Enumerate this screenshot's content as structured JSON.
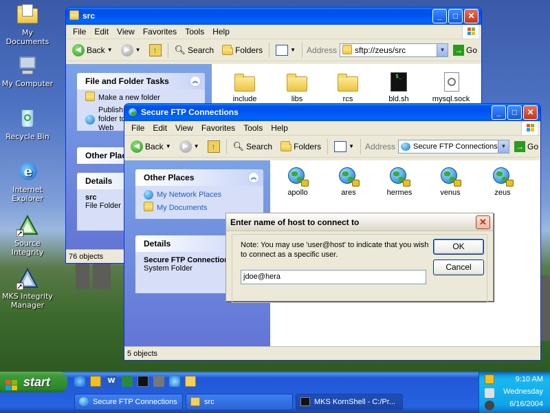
{
  "desktop": {
    "icons": [
      {
        "label": "My Documents",
        "icon": "my-documents-icon"
      },
      {
        "label": "My Computer",
        "icon": "my-computer-icon"
      },
      {
        "label": "Recycle Bin",
        "icon": "recycle-bin-icon"
      },
      {
        "label": "Internet Explorer",
        "icon": "internet-explorer-icon"
      },
      {
        "label": "Source Integrity",
        "icon": "source-integrity-icon"
      },
      {
        "label": "MKS Integrity Manager",
        "icon": "mks-integrity-manager-icon"
      }
    ]
  },
  "src_window": {
    "title": "src",
    "menu": [
      "File",
      "Edit",
      "View",
      "Favorites",
      "Tools",
      "Help"
    ],
    "toolbar": {
      "back": "Back",
      "search": "Search",
      "folders": "Folders",
      "address_label": "Address",
      "address_value": "sftp://zeus/src",
      "go": "Go"
    },
    "tasks": {
      "file_folder_tasks": {
        "title": "File and Folder Tasks",
        "items": [
          "Make a new folder",
          "Publish this folder to the Web"
        ]
      },
      "other_places": {
        "title": "Other Places"
      },
      "details": {
        "title": "Details",
        "name": "src",
        "type": "File Folder"
      }
    },
    "files": [
      {
        "name": "include",
        "icon": "folder-icon"
      },
      {
        "name": "libs",
        "icon": "folder-icon"
      },
      {
        "name": "rcs",
        "icon": "folder-icon"
      },
      {
        "name": "bld.sh",
        "icon": "shell-script-icon"
      },
      {
        "name": "mysql.sock",
        "icon": "socket-file-icon"
      }
    ],
    "status": "76 objects"
  },
  "ftp_window": {
    "title": "Secure FTP Connections",
    "menu": [
      "File",
      "Edit",
      "View",
      "Favorites",
      "Tools",
      "Help"
    ],
    "toolbar": {
      "back": "Back",
      "search": "Search",
      "folders": "Folders",
      "address_label": "Address",
      "address_value": "Secure FTP Connections",
      "go": "Go"
    },
    "tasks": {
      "other_places": {
        "title": "Other Places",
        "items": [
          "My Network Places",
          "My Documents"
        ]
      },
      "details": {
        "title": "Details",
        "name": "Secure FTP Connections",
        "type": "System Folder"
      }
    },
    "hosts": [
      "apollo",
      "ares",
      "hermes",
      "venus",
      "zeus"
    ],
    "status": "5 objects"
  },
  "dialog": {
    "title": "Enter name of host to connect to",
    "note": "Note:  You may use 'user@host' to indicate that you wish to connect as a specific user.",
    "input_value": "jdoe@hera",
    "ok": "OK",
    "cancel": "Cancel"
  },
  "taskbar": {
    "start": "start",
    "tasks": [
      "Secure FTP Connections",
      "src",
      "MKS KornShell - C:/Pr..."
    ],
    "clock": {
      "time": "9:10 AM",
      "day": "Wednesday",
      "date": "6/16/2004"
    }
  },
  "colors": {
    "xp_blue": "#0054e3",
    "task_pane": "#6375d6",
    "start_green": "#3c9a3a"
  }
}
